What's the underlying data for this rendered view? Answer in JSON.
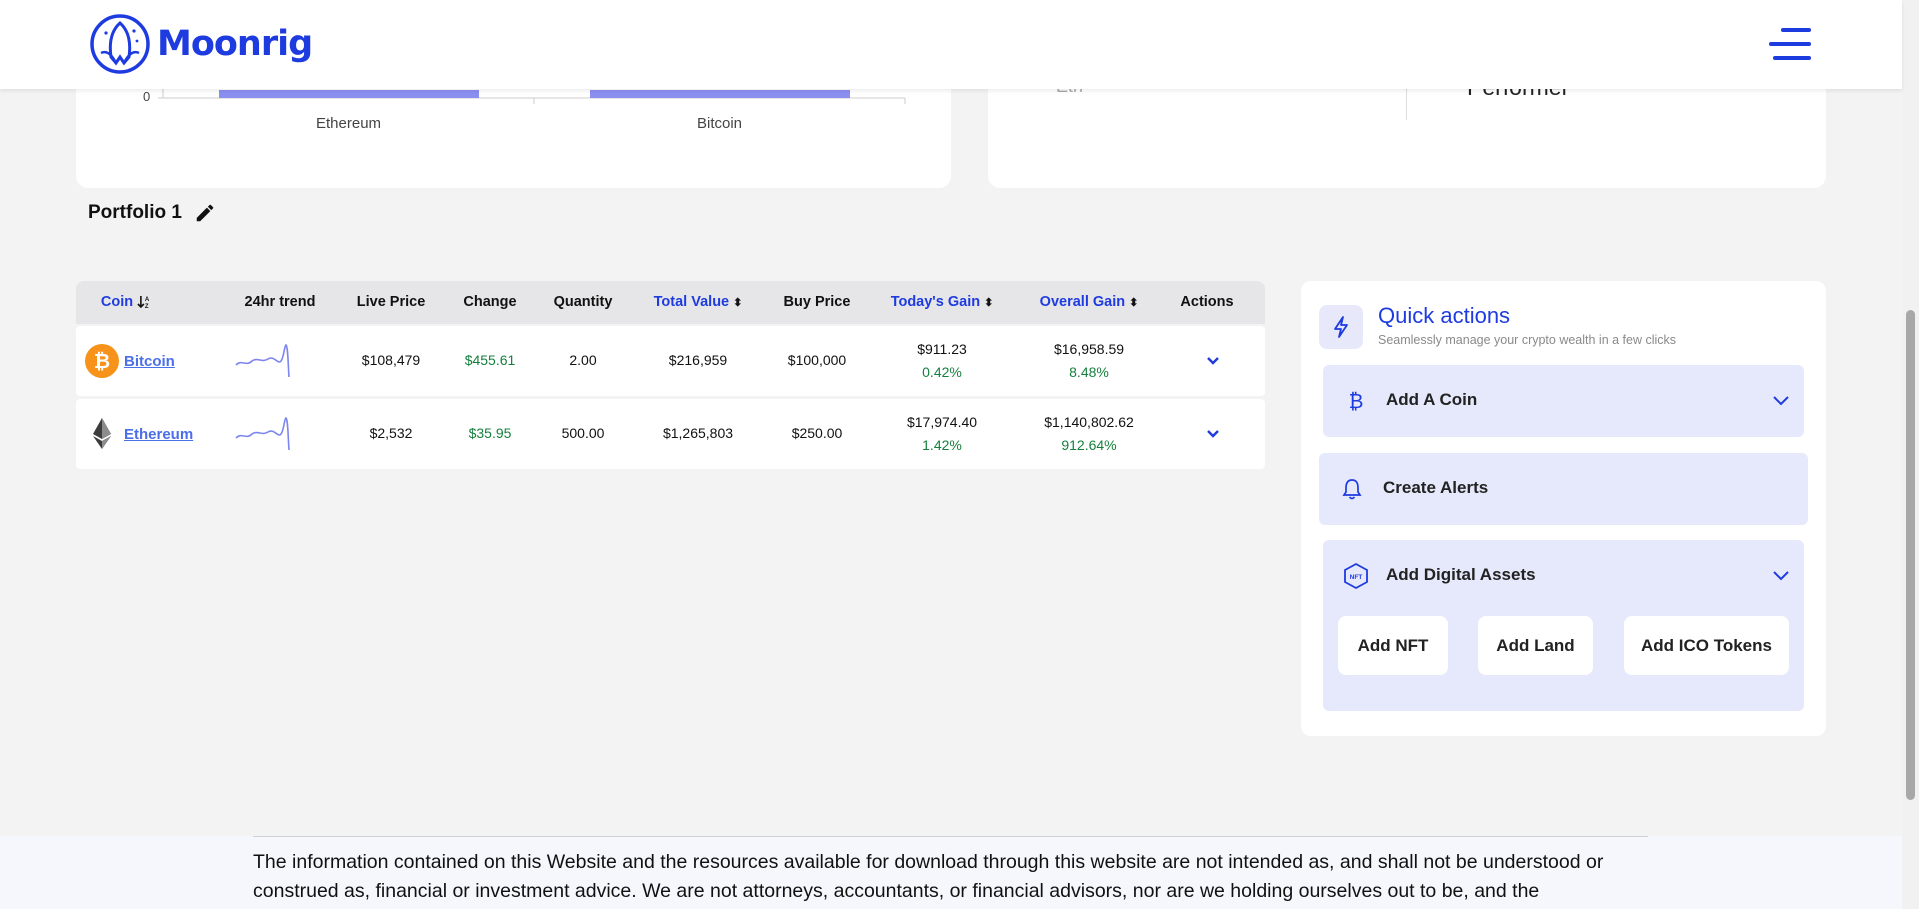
{
  "header": {
    "brand": "Moonrig"
  },
  "top_chart": {
    "zero_label": "0",
    "categories": [
      "Ethereum",
      "Bitcoin"
    ]
  },
  "right_card": {
    "ghost_left": "Eth",
    "ghost_right": "Performer"
  },
  "portfolio": {
    "title": "Portfolio 1"
  },
  "table": {
    "headers": {
      "coin": "Coin",
      "trend": "24hr trend",
      "live_price": "Live Price",
      "change": "Change",
      "quantity": "Quantity",
      "total_value": "Total Value",
      "buy_price": "Buy Price",
      "todays_gain": "Today's Gain",
      "overall_gain": "Overall Gain",
      "actions": "Actions"
    },
    "rows": [
      {
        "coin": "Bitcoin",
        "live_price": "$108,479",
        "change": "$455.61",
        "quantity": "2.00",
        "total_value": "$216,959",
        "buy_price": "$100,000",
        "todays_gain": "$911.23",
        "todays_gain_pct": "0.42%",
        "overall_gain": "$16,958.59",
        "overall_gain_pct": "8.48%"
      },
      {
        "coin": "Ethereum",
        "live_price": "$2,532",
        "change": "$35.95",
        "quantity": "500.00",
        "total_value": "$1,265,803",
        "buy_price": "$250.00",
        "todays_gain": "$17,974.40",
        "todays_gain_pct": "1.42%",
        "overall_gain": "$1,140,802.62",
        "overall_gain_pct": "912.64%"
      }
    ]
  },
  "quick_actions": {
    "title": "Quick actions",
    "subtitle": "Seamlessly manage your crypto wealth in a few clicks",
    "add_coin": "Add A Coin",
    "create_alerts": "Create Alerts",
    "add_digital_assets": "Add Digital Assets",
    "add_nft": "Add NFT",
    "add_land": "Add Land",
    "add_ico": "Add ICO Tokens"
  },
  "footer": {
    "disclaimer": "The information contained on this Website and the resources available for download through this website are not intended as, and shall not be understood or construed as, financial or investment advice. We are not attorneys, accountants, or financial advisors, nor are we holding ourselves out to be, and the"
  },
  "colors": {
    "brand_blue": "#1e3be0",
    "gain_green": "#15803d",
    "bar_purple": "#8a8ff0",
    "bitcoin_orange": "#f7931a"
  }
}
